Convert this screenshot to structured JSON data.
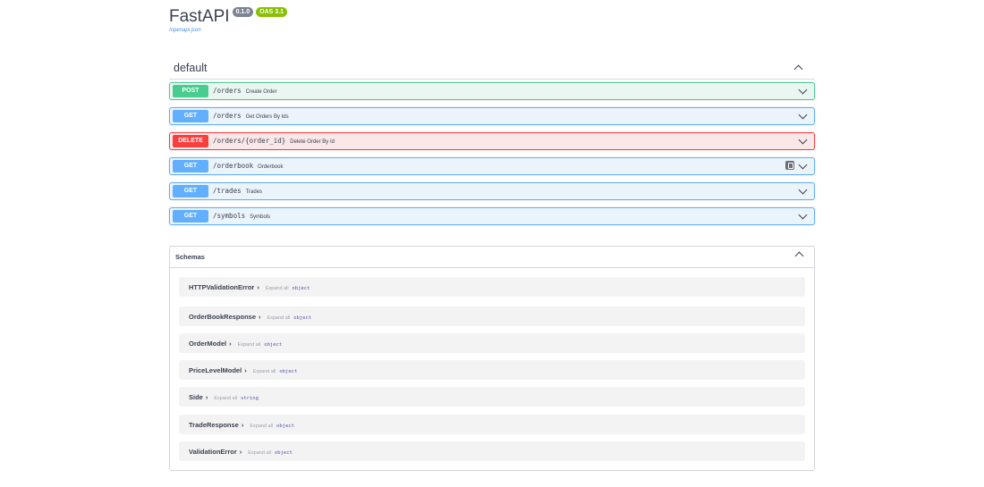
{
  "header": {
    "title": "FastAPI",
    "version_badge": "0.1.0",
    "oas_badge": "OAS 3.1",
    "spec_link": "/openapi.json"
  },
  "tag": {
    "name": "default"
  },
  "operations": [
    {
      "method": "POST",
      "path": "/orders",
      "summary": "Create Order"
    },
    {
      "method": "GET",
      "path": "/orders",
      "summary": "Get Orders By Ids"
    },
    {
      "method": "DELETE",
      "path": "/orders/{order_id}",
      "summary": "Delete Order By Id"
    },
    {
      "method": "GET",
      "path": "/orderbook",
      "summary": "Orderbook"
    },
    {
      "method": "GET",
      "path": "/trades",
      "summary": "Trades"
    },
    {
      "method": "GET",
      "path": "/symbols",
      "summary": "Symbols"
    }
  ],
  "schemas": {
    "title": "Schemas",
    "expand_label": "Expand all",
    "models": [
      {
        "name": "HTTPValidationError",
        "type": "object"
      },
      {
        "name": "OrderBookResponse",
        "type": "object"
      },
      {
        "name": "OrderModel",
        "type": "object"
      },
      {
        "name": "PriceLevelModel",
        "type": "object"
      },
      {
        "name": "Side",
        "type": "string"
      },
      {
        "name": "TradeResponse",
        "type": "object"
      },
      {
        "name": "ValidationError",
        "type": "object"
      }
    ]
  },
  "colors": {
    "post": "#49cc90",
    "get": "#61affe",
    "delete": "#f93e3e"
  },
  "icons": {
    "collapse": "chevron-up-icon",
    "expand": "chevron-down-icon",
    "copy": "copy-icon",
    "model_arrow": "chevron-right-icon"
  }
}
